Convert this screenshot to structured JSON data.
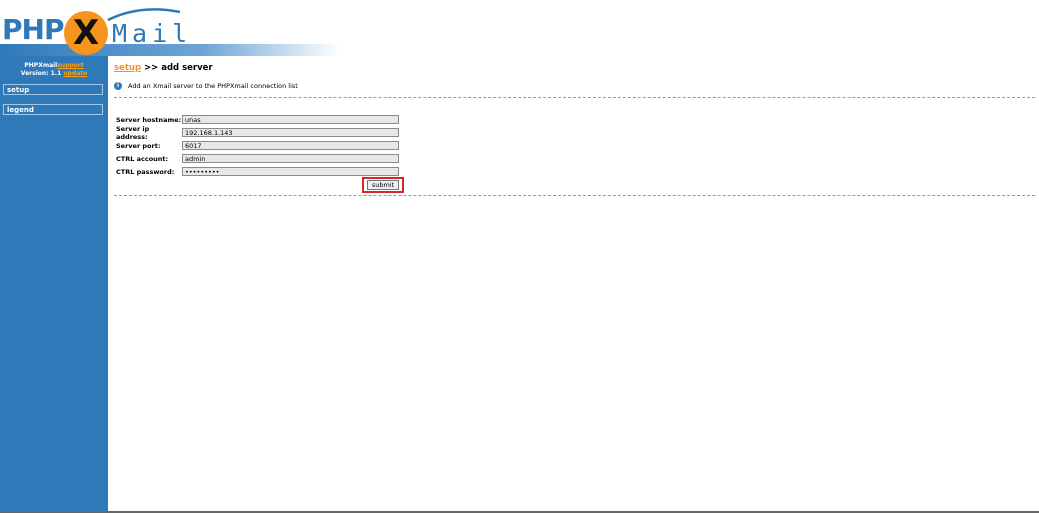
{
  "header": {
    "logo_left": "PHP",
    "logo_x": "X",
    "logo_right": "Mail"
  },
  "sidebar": {
    "version_app": "PHPXmail",
    "version_support": "support",
    "version_label": "Version: 1.1",
    "version_update": "update",
    "items": [
      {
        "label": "setup"
      },
      {
        "label": "legend"
      }
    ]
  },
  "main": {
    "breadcrumb_link": "setup",
    "breadcrumb_sep": ">>",
    "breadcrumb_current": "add server",
    "info_icon": "i",
    "info_text": "Add an Xmail server to the PHPXmail connection list",
    "form": {
      "hostname_label": "Server hostname:",
      "hostname_value": "unas",
      "ip_label": "Server ip address:",
      "ip_value": "192.168.1.143",
      "port_label": "Server port:",
      "port_value": "6017",
      "account_label": "CTRL account:",
      "account_value": "admin",
      "password_label": "CTRL password:",
      "password_value": "•••••••••",
      "submit_label": "submit"
    }
  },
  "icons": {
    "info": "info-icon"
  },
  "colors": {
    "brand_blue": "#2f79b9",
    "brand_orange": "#f7941d",
    "highlight_red": "#d9262c"
  }
}
